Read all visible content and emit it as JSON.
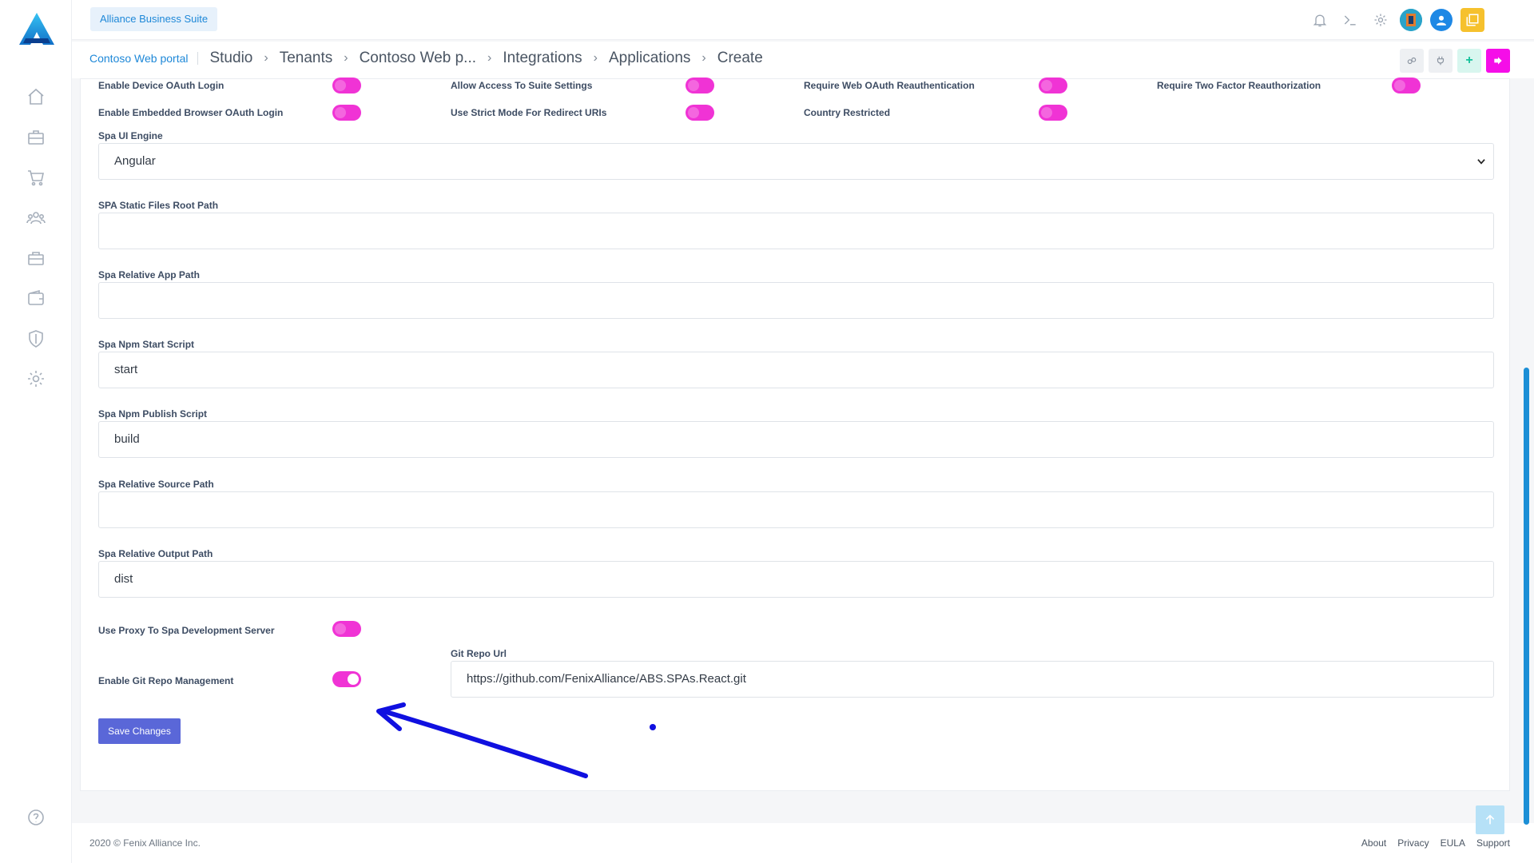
{
  "header": {
    "suite_badge": "Alliance Business Suite"
  },
  "breadcrumb": {
    "first": "Contoso Web portal",
    "items": [
      "Studio",
      "Tenants",
      "Contoso Web p...",
      "Integrations",
      "Applications",
      "Create"
    ]
  },
  "toggles_row1": [
    {
      "label": "Enable Device OAuth Login"
    },
    {
      "label": "Allow Access To Suite Settings"
    },
    {
      "label": "Require Web OAuth Reauthentication"
    },
    {
      "label": "Require Two Factor Reauthorization"
    }
  ],
  "toggles_row2": [
    {
      "label": "Enable Embedded Browser OAuth Login"
    },
    {
      "label": "Use Strict Mode For Redirect URIs"
    },
    {
      "label": "Country Restricted"
    }
  ],
  "form": {
    "spa_ui_engine": {
      "label": "Spa UI Engine",
      "value": "Angular"
    },
    "spa_static_files_root_path": {
      "label": "SPA Static Files Root Path",
      "value": ""
    },
    "spa_relative_app_path": {
      "label": "Spa Relative App Path",
      "value": ""
    },
    "spa_npm_start_script": {
      "label": "Spa Npm Start Script",
      "value": "start"
    },
    "spa_npm_publish_script": {
      "label": "Spa Npm Publish Script",
      "value": "build"
    },
    "spa_relative_source_path": {
      "label": "Spa Relative Source Path",
      "value": ""
    },
    "spa_relative_output_path": {
      "label": "Spa Relative Output Path",
      "value": "dist"
    },
    "use_proxy": {
      "label": "Use Proxy To Spa Development Server",
      "enabled": false
    },
    "git_repo_management": {
      "label": "Enable Git Repo Management",
      "enabled": true
    },
    "git_repo_url": {
      "label": "Git Repo Url",
      "value": "https://github.com/FenixAlliance/ABS.SPAs.React.git"
    },
    "save_label": "Save Changes"
  },
  "footer": {
    "copyright": "2020 © Fenix Alliance Inc.",
    "links": [
      "About",
      "Privacy",
      "EULA",
      "Support"
    ]
  },
  "colors": {
    "accent_pink": "#f033d5",
    "primary_blue": "#1e88d8",
    "save_button": "#5a67d8",
    "annotation": "#1010e0"
  }
}
